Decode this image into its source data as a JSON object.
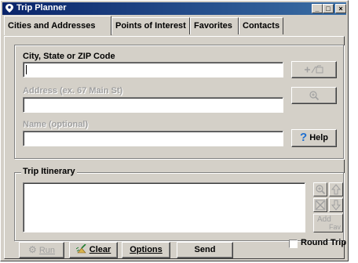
{
  "window": {
    "title": "Trip Planner",
    "controls": {
      "minimize": "_",
      "restore": "□",
      "close": "×"
    }
  },
  "tabs": [
    {
      "label": "Cities and Addresses",
      "active": true
    },
    {
      "label": "Points of Interest",
      "active": false
    },
    {
      "label": "Favorites",
      "active": false
    },
    {
      "label": "Contacts",
      "active": false
    }
  ],
  "address_form": {
    "city_label": "City, State or ZIP Code",
    "city_value": "",
    "address_label": "Address (ex. 67 Main St)",
    "address_value": "",
    "name_label": "Name (optional)",
    "name_value": ""
  },
  "side_buttons": {
    "add_icon": "add-to-itinerary-icon",
    "find_icon": "magnifier-icon",
    "help_label": "Help",
    "help_icon": "question-mark-icon"
  },
  "itinerary": {
    "label": "Trip Itinerary",
    "items": [],
    "zoom_icon": "magnifier-icon",
    "up_icon": "arrow-up-icon",
    "delete_icon": "delete-x-icon",
    "down_icon": "arrow-down-icon",
    "add_fav_label_1": "Add",
    "add_fav_label_2": "Fav"
  },
  "bottom": {
    "run_label": "Run",
    "clear_label": "Clear",
    "options_label": "Options",
    "send_label": "Send",
    "round_trip_label": "Round Trip",
    "round_trip_checked": false
  },
  "colors": {
    "titlebar": "#0a246a",
    "face": "#d4d0c8",
    "disabled_text": "#a0a0a0",
    "help_icon": "#1f6fd0"
  }
}
